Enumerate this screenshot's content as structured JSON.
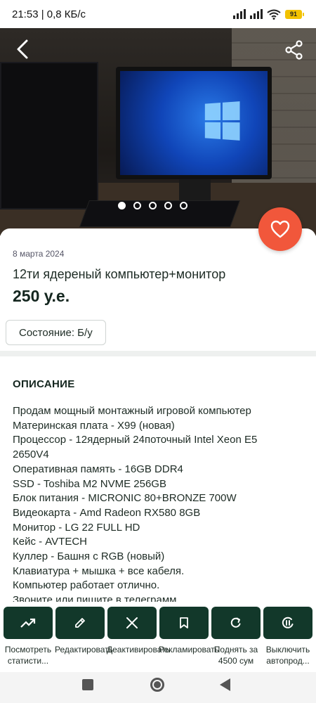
{
  "status_bar": {
    "time_and_speed": "21:53 | 0,8 КБ/с",
    "battery": "91"
  },
  "listing": {
    "date": "8 марта 2024",
    "title": "12ти ядереный компьютер+монитор",
    "price": "250 у.е.",
    "condition": "Состояние: Б/у",
    "gallery": {
      "photo_count": 5,
      "active_index": 0
    }
  },
  "description": {
    "heading": "ОПИСАНИЕ",
    "lines": [
      "Продам мощный монтажный игровой компьютер",
      "Материнская плата - X99 (новая)",
      "Процессор - 12ядерный 24поточный Intel Xeon E5",
      "2650V4",
      "Оперативная память - 16GB DDR4",
      "SSD - Toshiba M2 NVME 256GB",
      "Блок питания - MICRONIC 80+BRONZE 700W",
      "Видеокарта - Amd Radeon RX580 8GB",
      "Монитор - LG 22 FULL HD",
      "Кейс - AVTECH",
      "Куллер - Башня с RGB (новый)",
      "Клавиатура + мышка + все кабеля.",
      "Компьютер работает отлично.",
      "Звоните или пишите в телеграмм"
    ]
  },
  "actions": [
    {
      "icon": "trending-up-icon",
      "label": "Посмотреть статисти..."
    },
    {
      "icon": "pencil-icon",
      "label": "Редактировать"
    },
    {
      "icon": "close-icon",
      "label": "Деактивировать"
    },
    {
      "icon": "bookmark-icon",
      "label": "Рекламировать"
    },
    {
      "icon": "refresh-icon",
      "label": "Поднять за 4500 сум"
    },
    {
      "icon": "pause-icon",
      "label": "Выключить автопрод..."
    }
  ],
  "colors": {
    "accent_button": "#12382a",
    "favorite_button": "#f1573b"
  }
}
